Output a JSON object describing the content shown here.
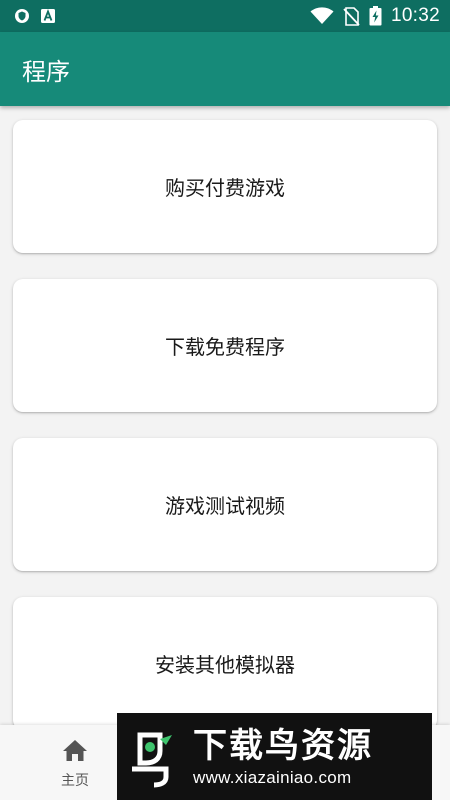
{
  "status_bar": {
    "time": "10:32",
    "icons": [
      "shield-icon",
      "a-icon",
      "wifi-icon",
      "no-sim-icon",
      "battery-charging-icon"
    ]
  },
  "app_bar": {
    "title": "程序"
  },
  "cards": [
    {
      "label": "购买付费游戏"
    },
    {
      "label": "下载免费程序"
    },
    {
      "label": "游戏测试视频"
    },
    {
      "label": "安装其他模拟器"
    }
  ],
  "bottom_nav": {
    "items": [
      {
        "label": "主页",
        "icon": "home-icon"
      }
    ]
  },
  "watermark": {
    "brand": "下载鸟资源",
    "url": "www.xiazainiao.com"
  },
  "colors": {
    "status_bar": "#0e6e61",
    "app_bar": "#168a79",
    "background": "#f3f3f3",
    "card": "#ffffff"
  }
}
